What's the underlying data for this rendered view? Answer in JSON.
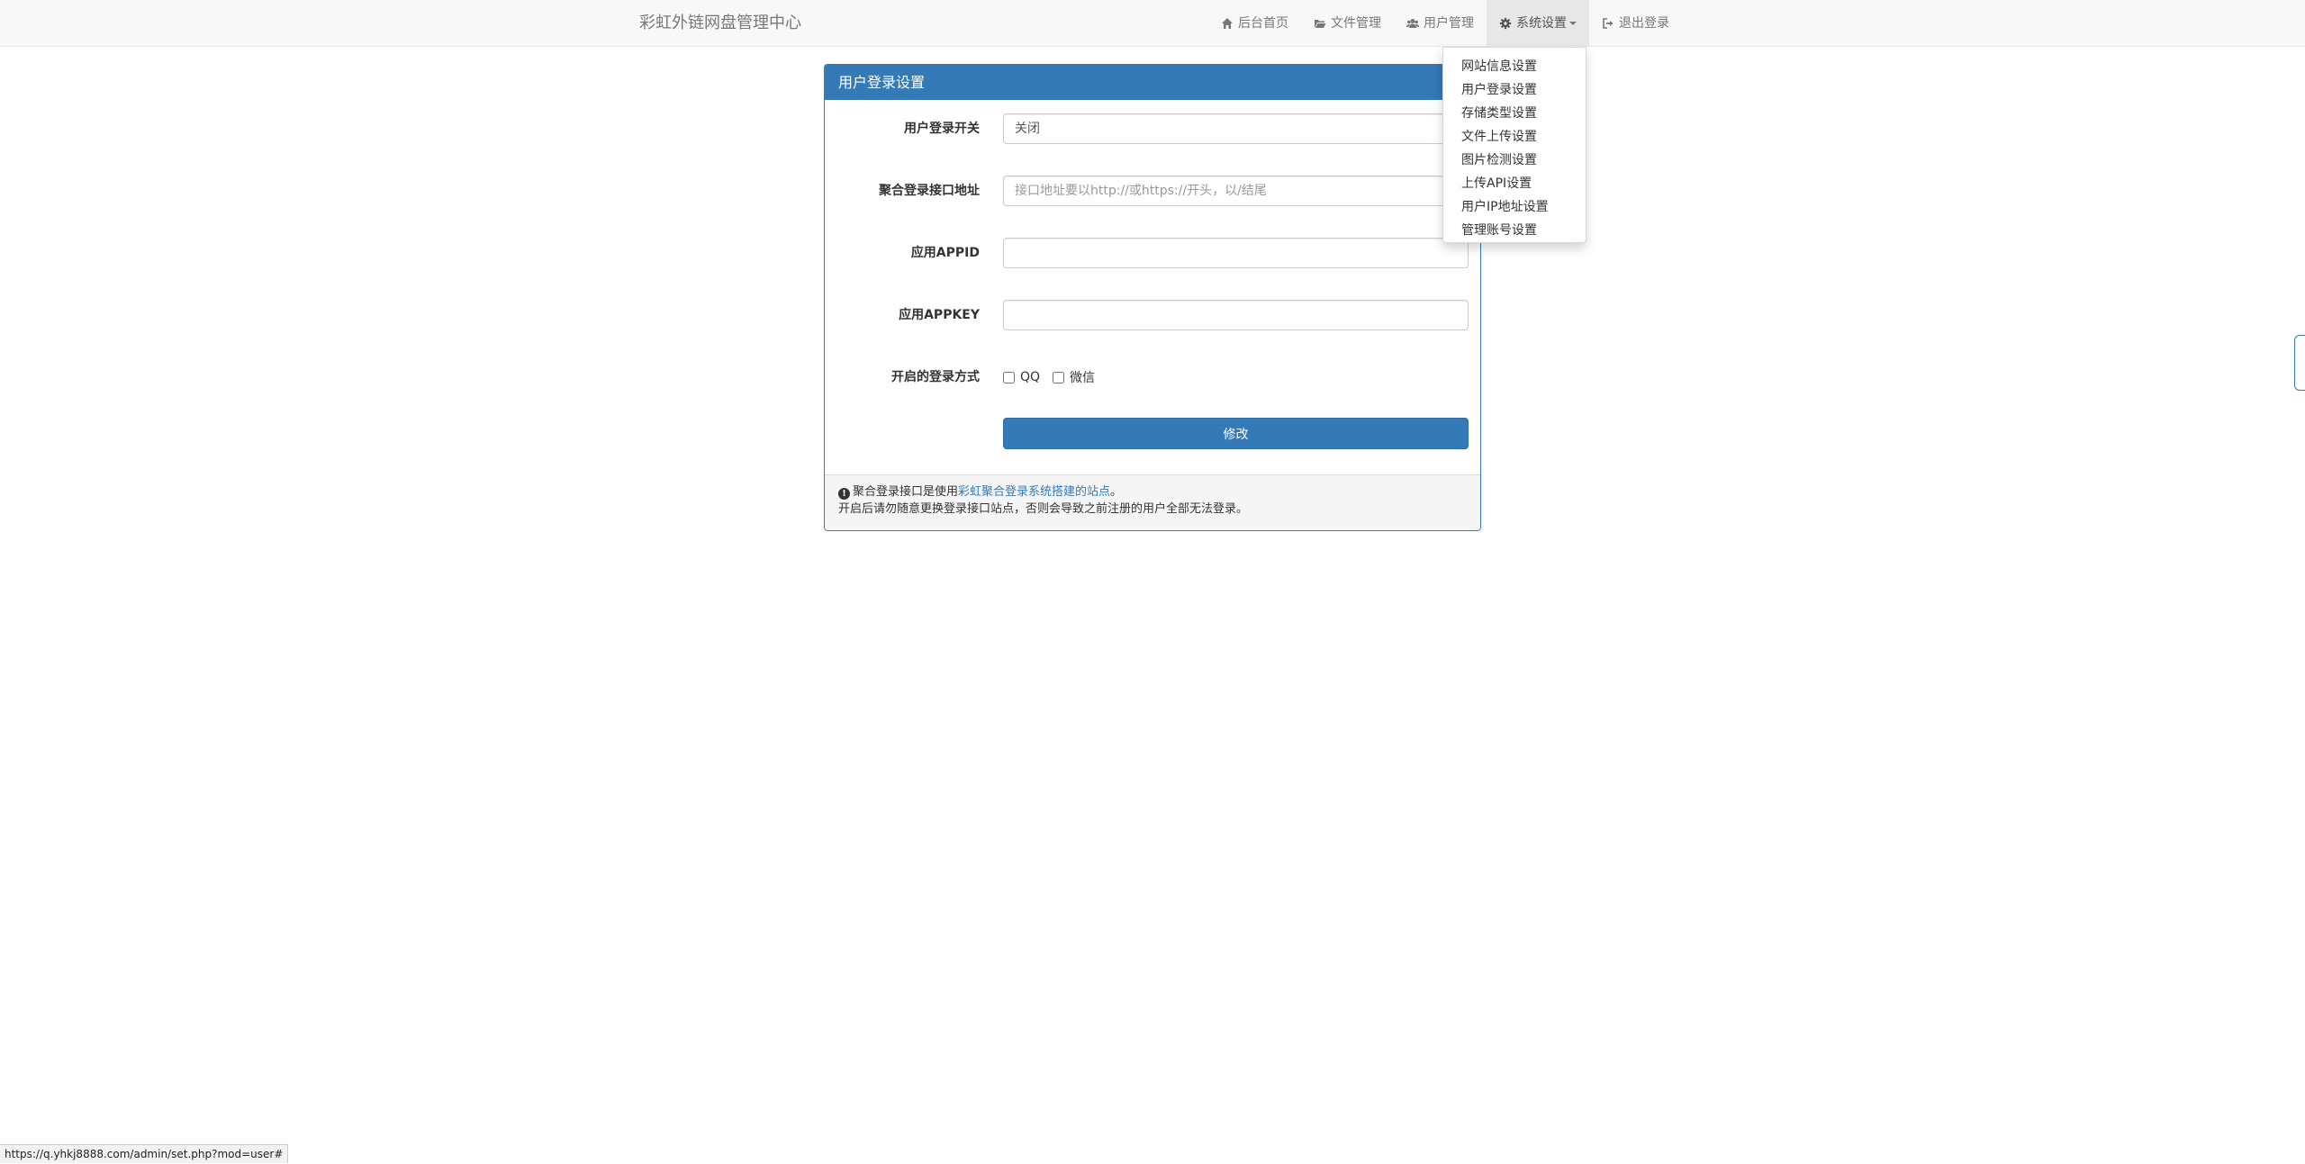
{
  "navbar": {
    "brand": "彩虹外链网盘管理中心",
    "items": [
      {
        "label": "后台首页",
        "icon": "home-icon"
      },
      {
        "label": "文件管理",
        "icon": "folder-open-icon"
      },
      {
        "label": "用户管理",
        "icon": "users-icon"
      },
      {
        "label": "系统设置",
        "icon": "gear-icon",
        "active": true
      },
      {
        "label": "退出登录",
        "icon": "sign-out-icon"
      }
    ]
  },
  "dropdown": {
    "items": [
      "网站信息设置",
      "用户登录设置",
      "存储类型设置",
      "文件上传设置",
      "图片检测设置",
      "上传API设置",
      "用户IP地址设置",
      "管理账号设置"
    ]
  },
  "panel": {
    "title": "用户登录设置",
    "fields": {
      "login_switch": {
        "label": "用户登录开关",
        "value": "关闭"
      },
      "api_url": {
        "label": "聚合登录接口地址",
        "placeholder": "接口地址要以http://或https://开头，以/结尾",
        "value": ""
      },
      "appid": {
        "label": "应用APPID",
        "value": ""
      },
      "appkey": {
        "label": "应用APPKEY",
        "value": ""
      },
      "login_methods": {
        "label": "开启的登录方式",
        "options": [
          "QQ",
          "微信"
        ]
      }
    },
    "submit_label": "修改",
    "footer": {
      "line1_prefix": "聚合登录接口是使用",
      "line1_link": "彩虹聚合登录系统搭建的站点",
      "line1_suffix": "。",
      "line2": "开启后请勿随意更换登录接口站点，否则会导致之前注册的用户全部无法登录。"
    }
  },
  "status_bar": {
    "url": "https://q.yhkj8888.com/admin/set.php?mod=user#"
  },
  "colors": {
    "primary": "#337ab7",
    "navbar_bg": "#f8f8f8"
  }
}
